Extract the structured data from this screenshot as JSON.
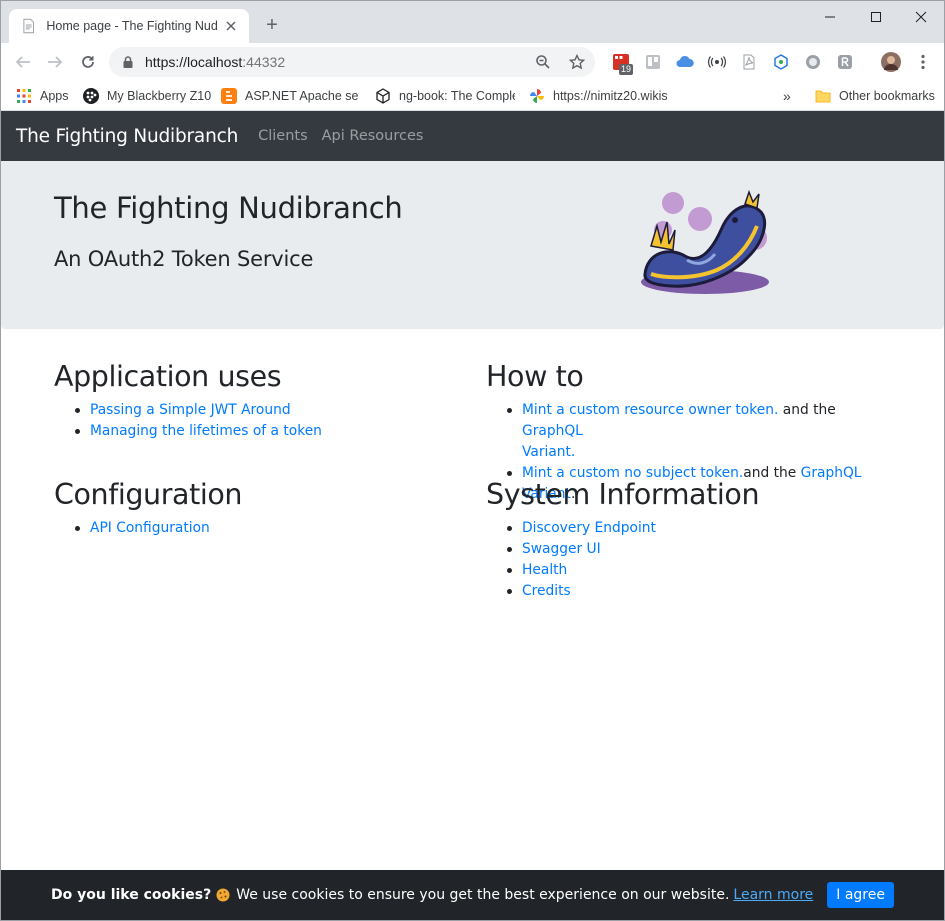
{
  "browser": {
    "tab_title": "Home page - The Fighting Nudib",
    "new_tab_symbol": "+",
    "url_host": "https://localhost",
    "url_port": ":44332",
    "extension_badge": "19",
    "bookmarks": [
      {
        "label": "Apps",
        "icon": "apps-grid-icon"
      },
      {
        "label": "My Blackberry Z10",
        "icon": "blackberry-icon"
      },
      {
        "label": "ASP.NET Apache setu",
        "icon": "blogger-icon"
      },
      {
        "label": "ng-book: The Comple",
        "icon": "cube-icon"
      },
      {
        "label": "https://nimitz20.wikis",
        "icon": "pinwheel-icon"
      }
    ],
    "bookmarks_overflow": "»",
    "other_bookmarks": "Other bookmarks"
  },
  "navbar": {
    "brand": "The Fighting Nudibranch",
    "links": [
      "Clients",
      "Api Resources"
    ]
  },
  "jumbotron": {
    "title": "The Fighting Nudibranch",
    "lead": "An OAuth2 Token Service"
  },
  "sections": {
    "application_uses": {
      "title": "Application uses",
      "items": [
        "Passing a Simple JWT Around",
        "Managing the lifetimes of a token"
      ]
    },
    "configuration": {
      "title": "Configuration",
      "items": [
        "API Configuration"
      ]
    },
    "how_to": {
      "title": "How to",
      "item1_link": "Mint a custom resource owner token.",
      "item1_text": " and the ",
      "item1_link2a": "GraphQL",
      "item1_link2b": "Variant.",
      "item2_link": "Mint a custom no subject token.",
      "item2_text": "and the ",
      "item2_link2": "GraphQL Variant",
      "item2_tail": "."
    },
    "system_information": {
      "title": "System Information",
      "items": [
        "Discovery Endpoint",
        "Swagger UI",
        "Health",
        "Credits"
      ]
    }
  },
  "cookie_banner": {
    "question": "Do you like cookies?",
    "message": "We use cookies to ensure you get the best experience on our website.",
    "learn_more": "Learn more",
    "agree": "I agree"
  },
  "colors": {
    "navbar_bg": "#343a40",
    "jumbotron_bg": "#e9ecef",
    "link": "#007bff",
    "cookie_bg": "#212529",
    "agree_btn": "#007bff"
  }
}
